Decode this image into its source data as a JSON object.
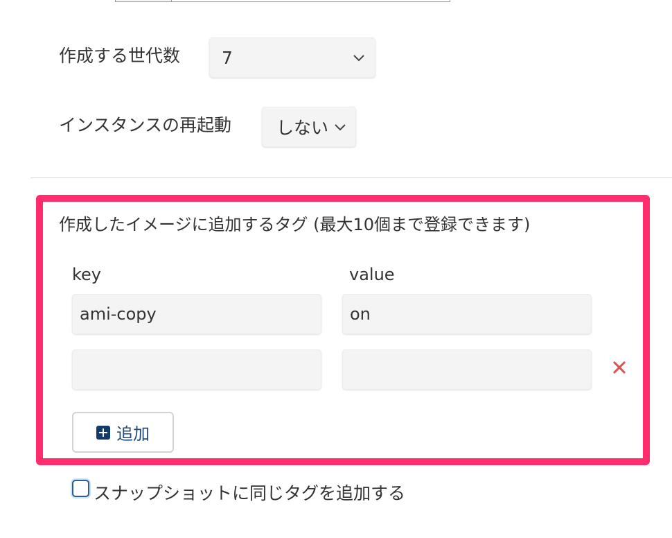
{
  "form": {
    "generations": {
      "label": "作成する世代数",
      "value": "7"
    },
    "reboot": {
      "label": "インスタンスの再起動",
      "value": "しない"
    }
  },
  "tags": {
    "title": "作成したイメージに追加するタグ (最大10個まで登録できます)",
    "key_header": "key",
    "value_header": "value",
    "rows": [
      {
        "key": "ami-copy",
        "value": "on"
      },
      {
        "key": "",
        "value": ""
      }
    ],
    "add_label": "追加"
  },
  "snapshot_checkbox": {
    "label": "スナップショットに同じタグを追加する",
    "checked": false
  },
  "colors": {
    "highlight": "#ff2d6d",
    "remove": "#d9534f",
    "add_icon": "#123a6a",
    "checkbox": "#2b5f93"
  }
}
